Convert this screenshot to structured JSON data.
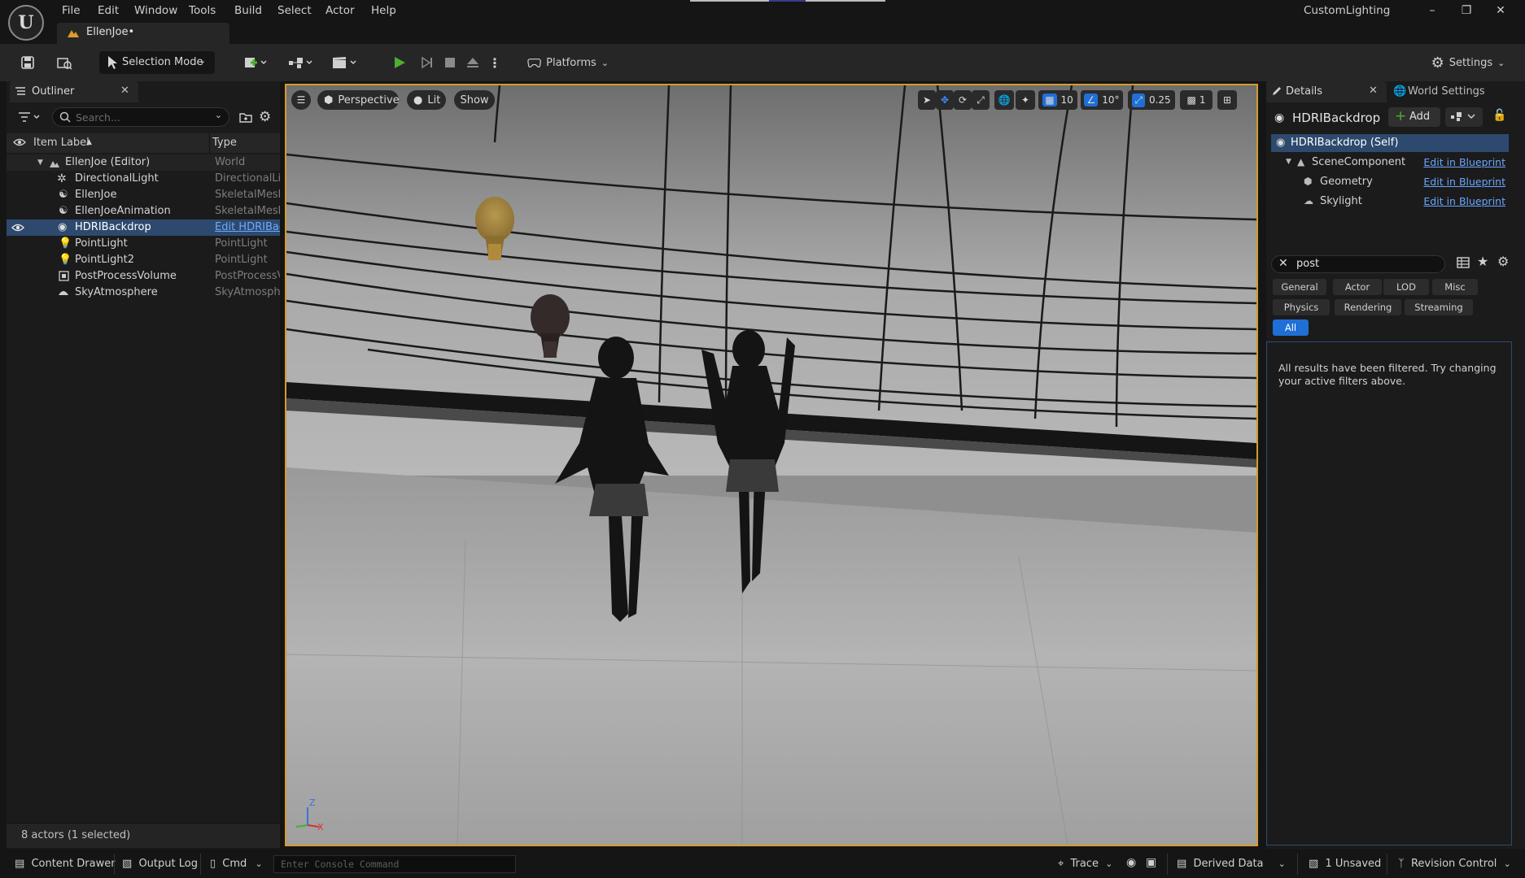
{
  "app": {
    "logo_text": "U",
    "window_title": "CustomLighting",
    "document_tab": "EllenJoe•"
  },
  "menu": [
    "File",
    "Edit",
    "Window",
    "Tools",
    "Build",
    "Select",
    "Actor",
    "Help"
  ],
  "toolbar": {
    "selection_mode": "Selection Mode",
    "platforms": "Platforms",
    "settings": "Settings"
  },
  "outliner": {
    "tab_label": "Outliner",
    "search_placeholder": "Search...",
    "columns": {
      "item_label": "Item Label",
      "type": "Type"
    },
    "rows": [
      {
        "label": "EllenJoe (Editor)",
        "type": "World",
        "icon": "world-icon"
      },
      {
        "label": "DirectionalLight",
        "type": "DirectionalLig",
        "icon": "directional-light-icon"
      },
      {
        "label": "EllenJoe",
        "type": "SkeletalMesh",
        "icon": "skeletal-mesh-icon"
      },
      {
        "label": "EllenJoeAnimation",
        "type": "SkeletalMesh",
        "icon": "skeletal-mesh-icon"
      },
      {
        "label": "HDRIBackdrop",
        "type": "Edit HDRIBacl",
        "icon": "blueprint-icon"
      },
      {
        "label": "PointLight",
        "type": "PointLight",
        "icon": "point-light-icon"
      },
      {
        "label": "PointLight2",
        "type": "PointLight",
        "icon": "point-light-icon"
      },
      {
        "label": "PostProcessVolume",
        "type": "PostProcessV",
        "icon": "post-process-icon"
      },
      {
        "label": "SkyAtmosphere",
        "type": "SkyAtmosphe",
        "icon": "sky-atmosphere-icon"
      }
    ],
    "status": "8 actors (1 selected)"
  },
  "viewport": {
    "view_mode": "Perspective",
    "lighting_mode": "Lit",
    "show": "Show",
    "grid_snap": "10",
    "rotation_snap": "10°",
    "scale_snap": "0.25",
    "camera_speed": "1",
    "axis": {
      "z": "Z",
      "x": "X"
    }
  },
  "details": {
    "tab_label": "Details",
    "world_settings_tab": "World Settings",
    "actor_name": "HDRIBackdrop",
    "add_label": "Add",
    "components": [
      {
        "label": "HDRIBackdrop (Self)",
        "link": ""
      },
      {
        "label": "SceneComponent",
        "link": "Edit in Blueprint"
      },
      {
        "label": "Geometry",
        "link": "Edit in Blueprint"
      },
      {
        "label": "Skylight",
        "link": "Edit in Blueprint"
      }
    ],
    "search_value": "post",
    "filters": [
      "General",
      "Actor",
      "LOD",
      "Misc",
      "Physics",
      "Rendering",
      "Streaming",
      "All"
    ],
    "filtered_message": "All results have been filtered. Try changing your active filters above."
  },
  "bottom": {
    "content_drawer": "Content Drawer",
    "output_log": "Output Log",
    "cmd": "Cmd",
    "console_placeholder": "Enter Console Command",
    "trace": "Trace",
    "derived_data": "Derived Data",
    "unsaved": "1 Unsaved",
    "revision_control": "Revision Control"
  },
  "colors": {
    "accent_blue": "#1f6fd6",
    "selection": "#2d4a6e",
    "viewport_border": "#d59a2e",
    "play_green": "#4caf32",
    "link": "#6aa6ff"
  }
}
